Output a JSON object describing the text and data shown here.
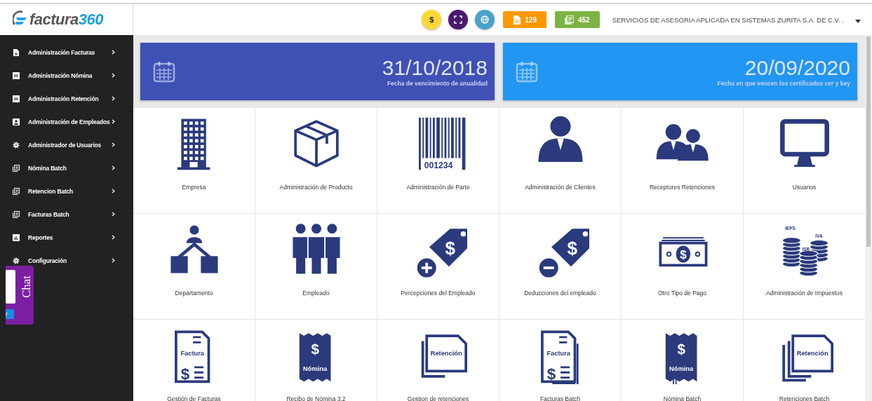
{
  "logo": {
    "text": "factura",
    "accent": "360"
  },
  "header": {
    "badges": [
      {
        "kind": "dollar",
        "text": "$",
        "color": "#fdd835"
      },
      {
        "kind": "expand",
        "color": "#4a1a6e"
      },
      {
        "kind": "globe",
        "color": "#4aa3c9"
      }
    ],
    "counters": [
      {
        "kind": "file",
        "text": "129",
        "color": "#ff9800"
      },
      {
        "kind": "stack",
        "text": "452",
        "color": "#7cb342"
      }
    ],
    "company": "SERVICIOS DE ASESORIA APLICADA EN SISTEMAS ZURITA S.A. DE C.V. ."
  },
  "sidebar": {
    "items": [
      {
        "kind": "file",
        "label": "Administración Facturas"
      },
      {
        "kind": "doc",
        "label": "Administración Nómina"
      },
      {
        "kind": "doc",
        "label": "Administración Retención"
      },
      {
        "kind": "badge",
        "label": "Administración de Empleados"
      },
      {
        "kind": "gear",
        "label": "Administrador de Usuarios"
      },
      {
        "kind": "stack",
        "label": "Nómina Batch"
      },
      {
        "kind": "stack",
        "label": "Retencion Batch"
      },
      {
        "kind": "stack",
        "label": "Facturas Batch"
      },
      {
        "kind": "chart",
        "label": "Reportes"
      },
      {
        "kind": "gear",
        "label": "Configuración"
      }
    ]
  },
  "chat": {
    "label": "Chat",
    "button": "r"
  },
  "cards": [
    {
      "date": "31/10/2018",
      "caption": "Fecha de vencimiento de anualidad",
      "color": "#3f51b5"
    },
    {
      "date": "20/09/2020",
      "caption": "Fecha en que vencen los certificados cer y key",
      "color": "#2196f3"
    }
  ],
  "tiles": [
    {
      "kind": "building",
      "label": "Empresa"
    },
    {
      "kind": "box",
      "label": "Administración de Producto"
    },
    {
      "kind": "barcode",
      "label": "Administración de Parte",
      "icon_text": [
        "001234"
      ]
    },
    {
      "kind": "person",
      "label": "Administración de Clientes"
    },
    {
      "kind": "pair",
      "label": "Receptores Retenciones"
    },
    {
      "kind": "monitor",
      "label": "Usuarios"
    },
    {
      "kind": "tree",
      "label": "Departamento"
    },
    {
      "kind": "group",
      "label": "Empleado"
    },
    {
      "kind": "tagplus",
      "label": "Percepciones del Empleado",
      "icon_text": [
        "$"
      ]
    },
    {
      "kind": "tagminus",
      "label": "Deducciones del empleado",
      "icon_text": [
        "$"
      ]
    },
    {
      "kind": "bill",
      "label": "Otro Tipo de Pago",
      "icon_text": [
        "$"
      ]
    },
    {
      "kind": "coins",
      "label": "Administración de Impuestos",
      "icon_text": [
        "IEPS",
        "ISR",
        "IVA"
      ]
    },
    {
      "kind": "invoice",
      "label": "Gestión de Facturas",
      "icon_text": [
        "Factura",
        "$"
      ]
    },
    {
      "kind": "receipt",
      "label": "Recibo de Nómina 3.2",
      "icon_text": [
        "$",
        "Nómina"
      ]
    },
    {
      "kind": "pages",
      "label": "Gestion de retenciones",
      "icon_text": [
        "Retención"
      ]
    },
    {
      "kind": "invoices",
      "label": "Facturas Batch",
      "icon_text": [
        "Factura",
        "$"
      ]
    },
    {
      "kind": "receipts",
      "label": "Nómina Batch",
      "icon_text": [
        "$",
        "Nómina"
      ]
    },
    {
      "kind": "pagestack",
      "label": "Retenciones Batch",
      "icon_text": [
        "Retención"
      ]
    }
  ]
}
